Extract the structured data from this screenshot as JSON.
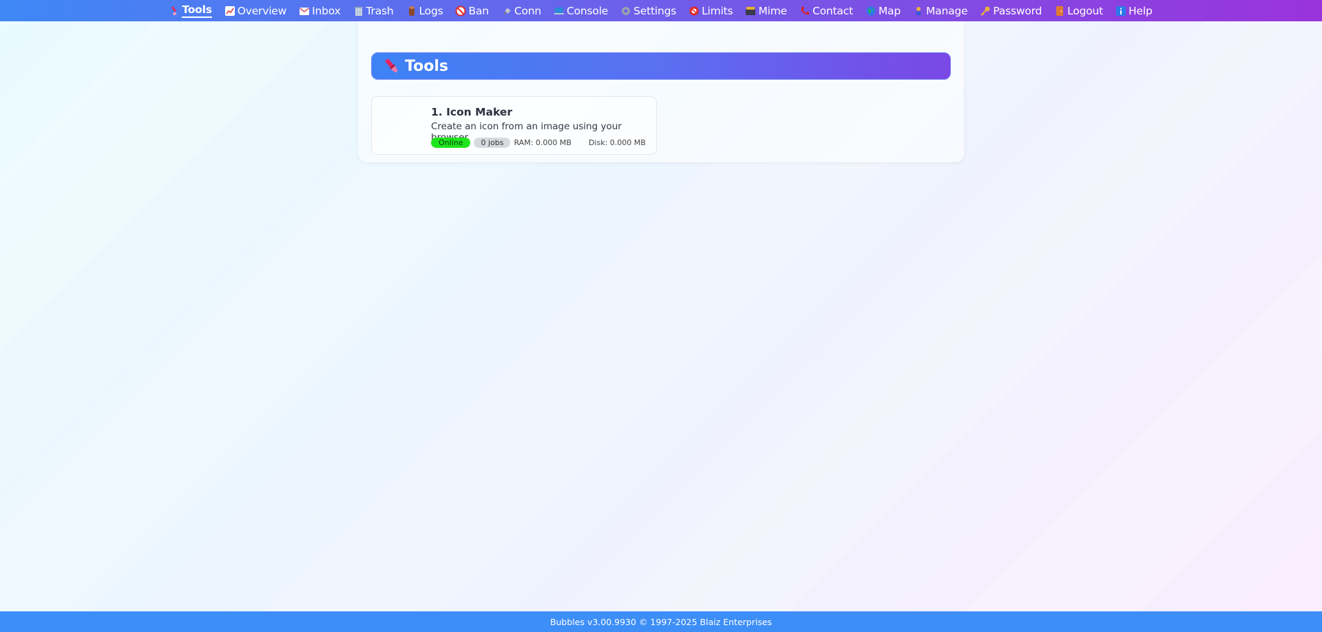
{
  "nav": {
    "items": [
      {
        "label": "Tools",
        "icon": "brush-icon",
        "color": "#e8245f",
        "active": true
      },
      {
        "label": "Overview",
        "icon": "chart-icon",
        "color": "#e24a4a",
        "active": false
      },
      {
        "label": "Inbox",
        "icon": "inbox-icon",
        "color": "#d84a6a",
        "active": false
      },
      {
        "label": "Trash",
        "icon": "trash-icon",
        "color": "#8fa7c0",
        "active": false
      },
      {
        "label": "Logs",
        "icon": "log-icon",
        "color": "#8a4a2a",
        "active": false
      },
      {
        "label": "Ban",
        "icon": "ban-icon",
        "color": "#e22828",
        "active": false
      },
      {
        "label": "Conn",
        "icon": "plug-icon",
        "color": "#7a7a8a",
        "active": false
      },
      {
        "label": "Console",
        "icon": "laptop-icon",
        "color": "#2a8ad8",
        "active": false
      },
      {
        "label": "Settings",
        "icon": "gear-icon",
        "color": "#8a8a9a",
        "active": false
      },
      {
        "label": "Limits",
        "icon": "no-entry-icon",
        "color": "#e22828",
        "active": false
      },
      {
        "label": "Mime",
        "icon": "card-box-icon",
        "color": "#d8a020",
        "active": false
      },
      {
        "label": "Contact",
        "icon": "phone-icon",
        "color": "#d82020",
        "active": false
      },
      {
        "label": "Map",
        "icon": "globe-icon",
        "color": "#2aa86a",
        "active": false
      },
      {
        "label": "Manage",
        "icon": "person-icon",
        "color": "#e8b040",
        "active": false
      },
      {
        "label": "Password",
        "icon": "key-icon",
        "color": "#e8b040",
        "active": false
      },
      {
        "label": "Logout",
        "icon": "door-icon",
        "color": "#e07a30",
        "active": false
      },
      {
        "label": "Help",
        "icon": "info-icon",
        "color": "#2a7ae8",
        "active": false
      }
    ]
  },
  "section": {
    "title": "Tools",
    "icon": "brush-icon"
  },
  "tools": [
    {
      "name": "1. Icon Maker",
      "description": "Create an icon from an image using your browser.",
      "status": "Online",
      "jobs": "0 jobs",
      "ram": "RAM: 0.000 MB",
      "disk": "Disk: 0.000 MB"
    }
  ],
  "footer": {
    "text": "Bubbles v3.00.9930 © 1997-2025 Blaiz Enterprises"
  }
}
